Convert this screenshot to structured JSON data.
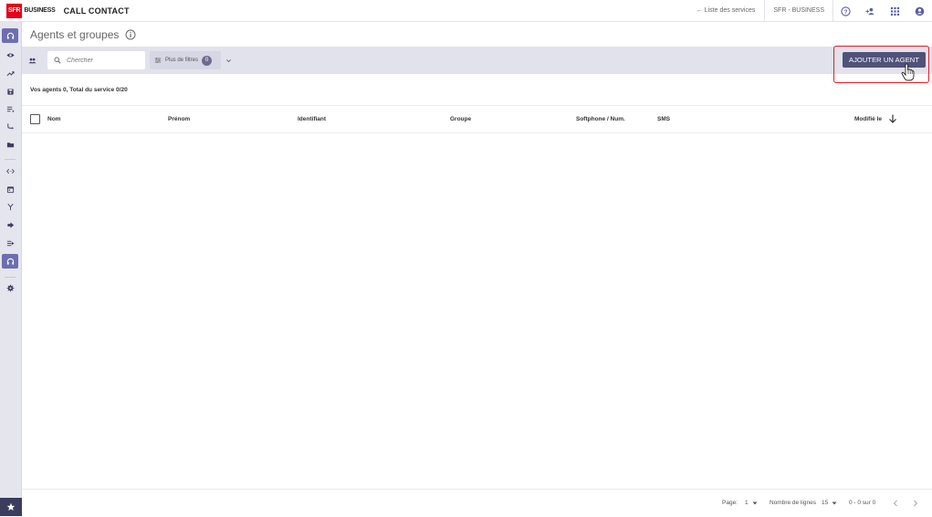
{
  "topbar": {
    "logo_sfr": "SFR",
    "logo_business": "BUSINESS",
    "app_title": "CALL CONTACT",
    "services_link": "← Liste des services",
    "account_name": "SFR - BUSINESS",
    "icons": [
      "help-icon",
      "add-user-icon",
      "apps-grid-icon",
      "account-icon"
    ]
  },
  "sidebar": {
    "items": [
      {
        "icon": "headset-icon",
        "active": true
      },
      {
        "icon": "eye-icon"
      },
      {
        "icon": "trending-icon"
      },
      {
        "icon": "save-icon"
      },
      {
        "icon": "list-icon"
      },
      {
        "icon": "routing-icon"
      },
      {
        "icon": "folder-icon"
      },
      {
        "icon": "code-icon"
      },
      {
        "icon": "calendar-icon"
      },
      {
        "icon": "merge-icon"
      },
      {
        "icon": "forward-icon"
      },
      {
        "icon": "queue-icon"
      },
      {
        "icon": "headset-icon",
        "active": true
      },
      {
        "icon": "settings-icon"
      }
    ],
    "bottom_icon": "star-icon"
  },
  "page": {
    "title": "Agents et groupes"
  },
  "filterbar": {
    "search_placeholder": "Chercher",
    "filters_label": "Plus de filtres",
    "filters_count": "0",
    "add_button": "AJOUTER UN AGENT"
  },
  "summary": {
    "count_text": "Vos agents 0, Total du service 0/20"
  },
  "table": {
    "columns": [
      "Nom",
      "Prénom",
      "Identifiant",
      "Groupe",
      "Softphone / Num.",
      "SMS",
      "Modifié le"
    ],
    "rows": []
  },
  "footer": {
    "page_label": "Page:",
    "page_value": "1",
    "rows_label": "Nombre de lignes",
    "rows_value": "15",
    "range_text": "0 - 0 sur 0"
  },
  "colors": {
    "accent": "#50527a",
    "sidebar_active": "#6d6eb0",
    "highlight": "#e0202a",
    "brand_red": "#e2001a"
  }
}
